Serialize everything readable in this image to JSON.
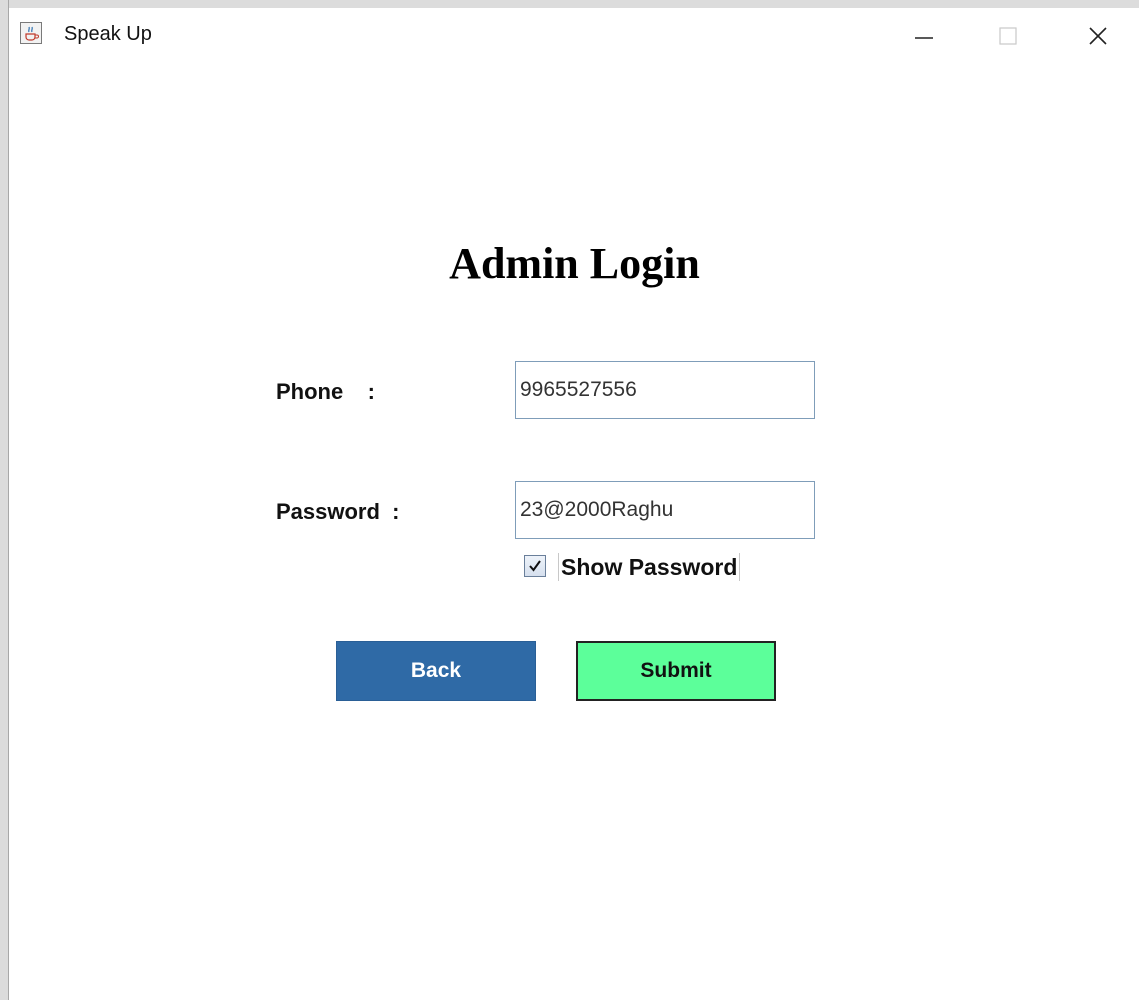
{
  "window": {
    "title": "Speak Up",
    "app_icon": "java-cup-icon",
    "controls": [
      "minimize-icon",
      "maximize-icon",
      "close-icon"
    ]
  },
  "form": {
    "heading": "Admin Login",
    "phone_label": "Phone    :",
    "phone_value": "9965527556",
    "password_label": "Password  :",
    "password_value": "23@2000Raghu",
    "show_password_label": "Show Password",
    "show_password_checked": true
  },
  "buttons": {
    "back_label": "Back",
    "submit_label": "Submit"
  },
  "colors": {
    "back_button": "#2f6aa6",
    "submit_button": "#5cff9a"
  }
}
